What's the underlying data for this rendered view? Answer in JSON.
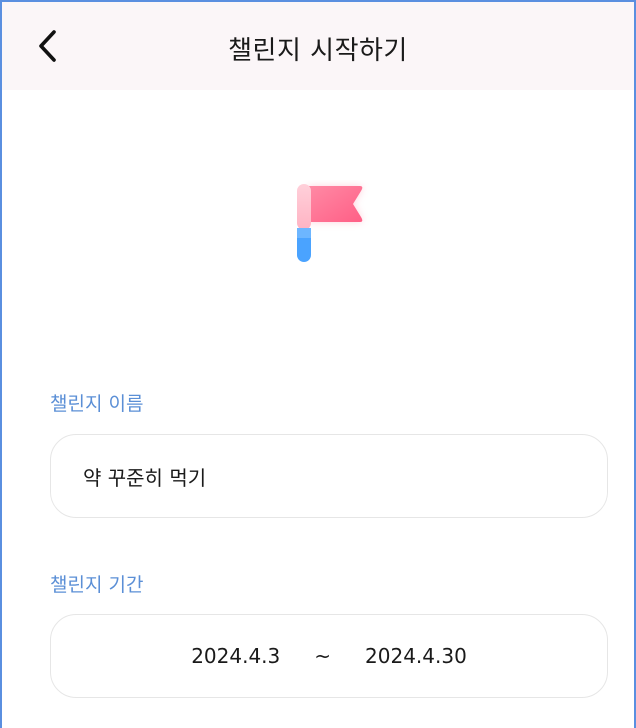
{
  "header": {
    "title": "챌린지 시작하기",
    "back_icon": "chevron-left-icon"
  },
  "hero": {
    "icon": "flag-icon",
    "colors": {
      "flag_pink": "#ff6f91",
      "pole_light_pink": "#ffc3cf",
      "pole_blue": "#4aa3ff"
    }
  },
  "challenge_name": {
    "label": "챌린지 이름",
    "value": "약 꾸준히 먹기"
  },
  "challenge_period": {
    "label": "챌린지 기간",
    "start": "2024.4.3",
    "separator": "~",
    "end": "2024.4.30"
  },
  "colors": {
    "accent": "#5b8fd6",
    "header_bg": "#fbf6f8"
  }
}
